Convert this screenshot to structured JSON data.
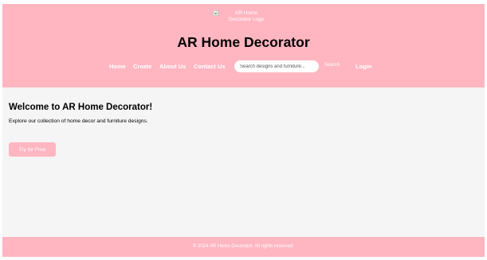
{
  "colors": {
    "brand_pink": "#ffb6c1",
    "page_background": "#f5f5f5",
    "text_dark": "#000000",
    "text_light": "#ffffff"
  },
  "header": {
    "logo_alt": "AR Home Decorator Logo",
    "logo_icon": "broken-image-icon",
    "title": "AR Home Decorator"
  },
  "nav": {
    "home": "Home",
    "create": "Create",
    "about": "About Us",
    "contact": "Contact Us",
    "search_placeholder": "Search designs and furniture...",
    "search_label": "Search",
    "login": "Login"
  },
  "main": {
    "heading": "Welcome to AR Home Decorator!",
    "description": "Explore our collection of home decor and furniture designs.",
    "cta_label": "Try for Free"
  },
  "footer": {
    "copyright": "© 2024 AR Home Decorator. All rights reserved."
  }
}
